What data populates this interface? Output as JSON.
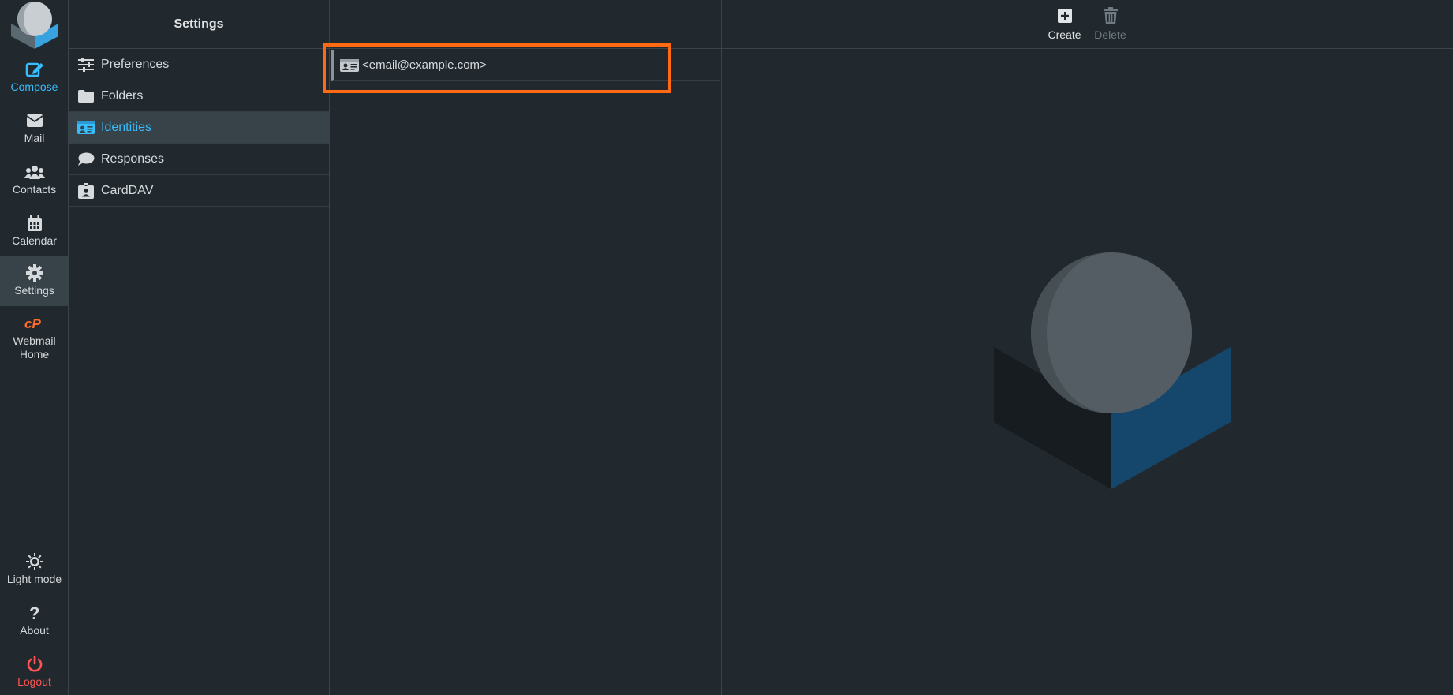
{
  "nav": {
    "items": [
      {
        "label": "Compose",
        "icon": "compose-icon"
      },
      {
        "label": "Mail",
        "icon": "envelope-icon"
      },
      {
        "label": "Contacts",
        "icon": "users-icon"
      },
      {
        "label": "Calendar",
        "icon": "calendar-icon"
      },
      {
        "label": "Settings",
        "icon": "gear-icon"
      },
      {
        "label": "Webmail Home",
        "icon": "cpanel-icon"
      }
    ],
    "bottom": [
      {
        "label": "Light mode",
        "icon": "sun-icon"
      },
      {
        "label": "About",
        "icon": "question-icon"
      },
      {
        "label": "Logout",
        "icon": "power-icon"
      }
    ]
  },
  "settings": {
    "title": "Settings",
    "items": [
      {
        "label": "Preferences",
        "icon": "sliders-icon"
      },
      {
        "label": "Folders",
        "icon": "folder-icon"
      },
      {
        "label": "Identities",
        "icon": "id-card-icon"
      },
      {
        "label": "Responses",
        "icon": "comment-icon"
      },
      {
        "label": "CardDAV",
        "icon": "badge-icon"
      }
    ],
    "active": "Identities"
  },
  "identities": {
    "rows": [
      {
        "label": "<email@example.com>",
        "icon": "id-card-icon"
      }
    ]
  },
  "toolbar": {
    "create_label": "Create",
    "delete_label": "Delete"
  },
  "colors": {
    "accent": "#37beff",
    "highlight": "#ff6a13",
    "logout": "#ff5552",
    "background": "#22292e",
    "active_bg": "#374249"
  }
}
